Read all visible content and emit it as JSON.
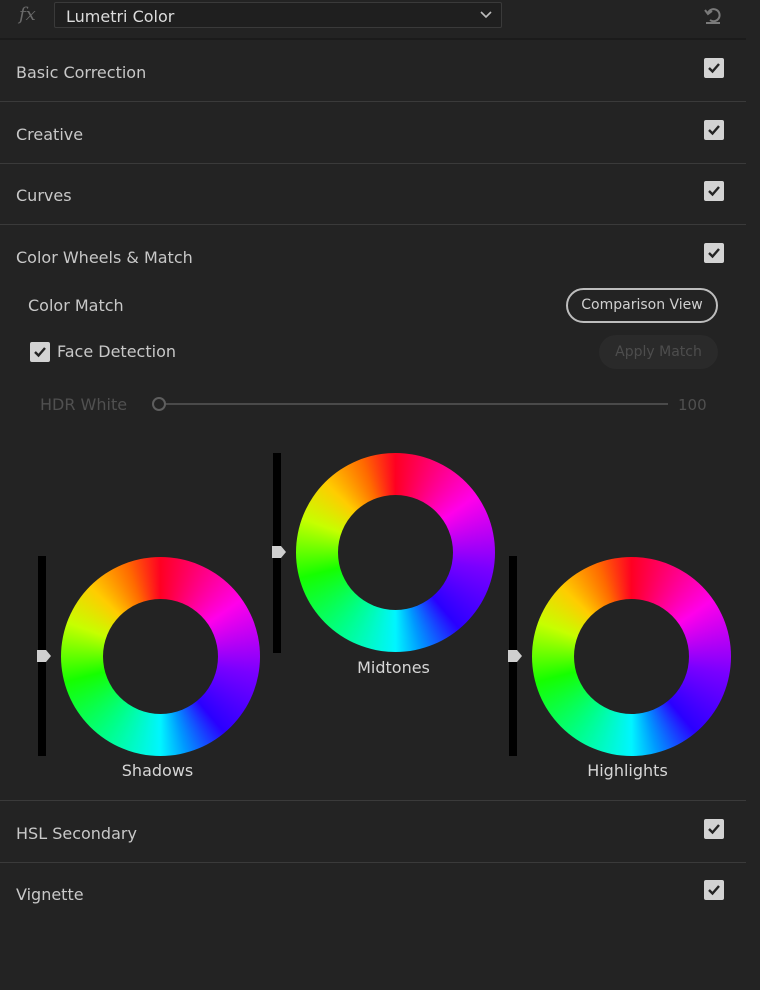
{
  "header": {
    "fx_label": "fx",
    "effect_name": "Lumetri Color"
  },
  "sections": {
    "basic_correction": {
      "label": "Basic Correction",
      "checked": true
    },
    "creative": {
      "label": "Creative",
      "checked": true
    },
    "curves": {
      "label": "Curves",
      "checked": true
    },
    "color_wheels": {
      "label": "Color Wheels & Match",
      "checked": true
    },
    "hsl_secondary": {
      "label": "HSL Secondary",
      "checked": true
    },
    "vignette": {
      "label": "Vignette",
      "checked": true
    }
  },
  "color_match": {
    "label": "Color Match",
    "comparison_view_label": "Comparison View",
    "face_detection_label": "Face Detection",
    "face_detection_checked": true,
    "apply_match_label": "Apply Match",
    "hdr_white_label": "HDR White",
    "hdr_white_value": "100"
  },
  "wheels": {
    "shadows_label": "Shadows",
    "midtones_label": "Midtones",
    "highlights_label": "Highlights"
  },
  "colors": {
    "background": "#232323",
    "checkbox": "#d3d3d3",
    "divider": "#3a3a3a"
  },
  "icons": [
    "chevron-down-icon",
    "reset-icon",
    "checkmark-icon"
  ]
}
